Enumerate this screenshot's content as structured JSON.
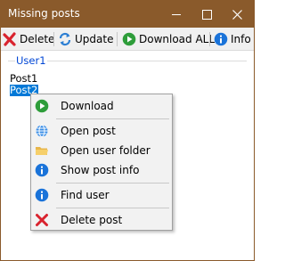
{
  "window": {
    "title": "Missing posts"
  },
  "toolbar": {
    "delete_label": "Delete",
    "update_label": "Update",
    "download_all_label": "Download ALL",
    "info_label": "Info"
  },
  "group": {
    "label": "User1"
  },
  "posts": [
    "Post1",
    "Post2"
  ],
  "context_menu": {
    "download": "Download",
    "open_post": "Open post",
    "open_user_folder": "Open user folder",
    "show_post_info": "Show post info",
    "find_user": "Find user",
    "delete_post": "Delete post"
  },
  "colors": {
    "titlebar": "#8a5a2b",
    "selection": "#0078d7",
    "group_label": "#0046d5"
  },
  "icons": {
    "delete": "red-x-icon",
    "update": "refresh-arrows-icon",
    "download_all": "green-play-icon",
    "info": "blue-info-icon",
    "open_post": "globe-icon",
    "open_user_folder": "folder-icon"
  }
}
